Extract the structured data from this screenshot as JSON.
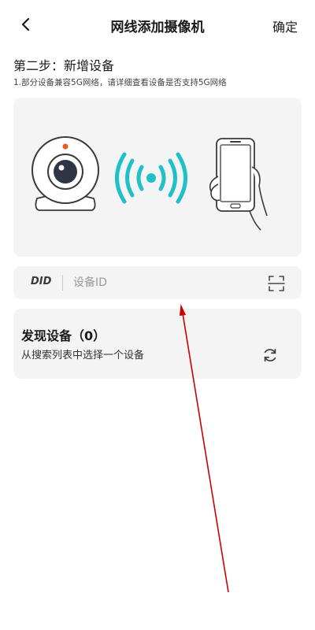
{
  "header": {
    "title": "网线添加摄像机",
    "confirm_label": "确定",
    "back_icon": "chevron-left-icon"
  },
  "step": {
    "title": "第二步：新增设备",
    "note": "1.部分设备兼容5G网络，请详细查看设备是否支持5G网络"
  },
  "illustration": {
    "icons": [
      "webcam-icon",
      "wifi-signal-icon",
      "phone-in-hand-icon"
    ],
    "signal_color": "#1fc0c8"
  },
  "did_field": {
    "label": "DID",
    "placeholder": "设备ID",
    "value": "",
    "scan_icon": "scan-icon"
  },
  "discovery": {
    "title": "发现设备（0）",
    "subtitle": "从搜索列表中选择一个设备",
    "refresh_icon": "refresh-icon"
  },
  "colors": {
    "card_bg": "#f4f4f4",
    "annotation_arrow": "#cc0000"
  }
}
